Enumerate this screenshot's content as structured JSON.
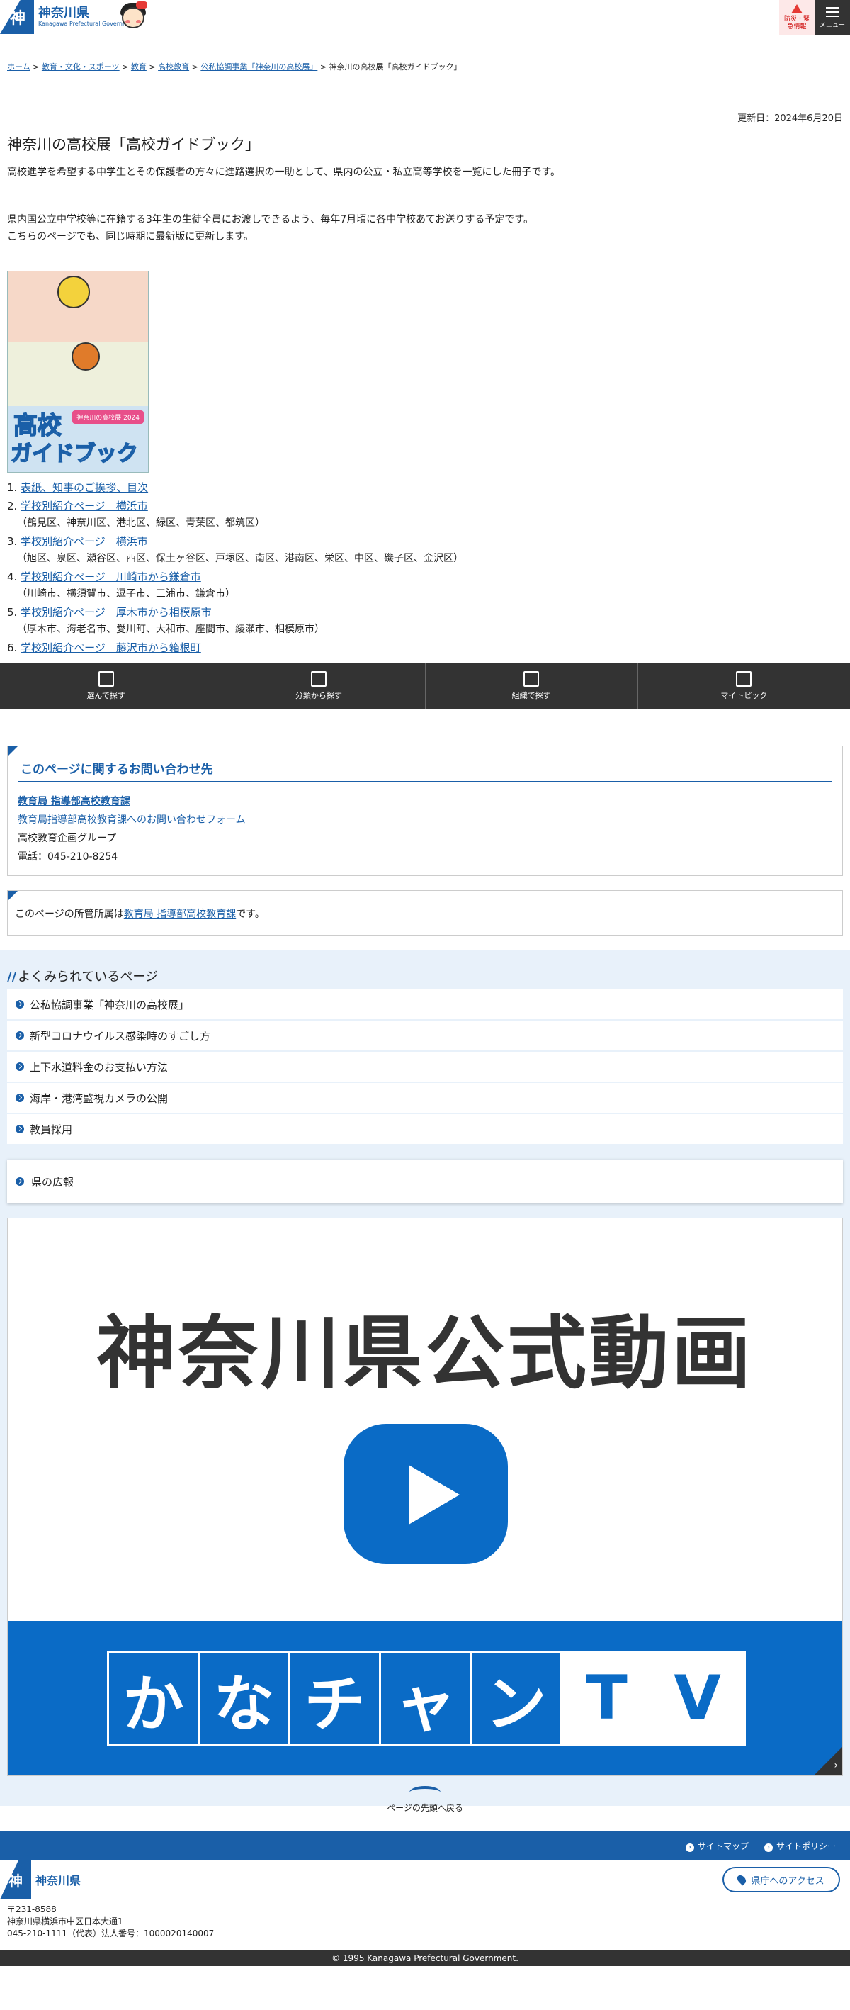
{
  "header": {
    "logo_jp": "神奈川県",
    "logo_en": "Kanagawa Prefectural Government",
    "logo_mark": "神",
    "alert_label_1": "防災・緊",
    "alert_label_2": "急情報",
    "menu_label": "メニュー"
  },
  "breadcrumb": {
    "items": [
      "ホーム",
      "教育・文化・スポーツ",
      "教育",
      "高校教育",
      "公私協調事業「神奈川の高校展」"
    ],
    "current": "神奈川の高校展「高校ガイドブック」",
    "sep": " > "
  },
  "page": {
    "updated": "更新日：2024年6月20日",
    "title": "神奈川の高校展「高校ガイドブック」",
    "intro": "高校進学を希望する中学生とその保護者の方々に進路選択の一助として、県内の公立・私立高等学校を一覧にした冊子です。",
    "para2_line1": "県内国公立中学校等に在籍する3年生の生徒全員にお渡しできるよう、毎年7月頃に各中学校あてお送りする予定です。",
    "para2_line2": "こちらのページでも、同じ時期に最新版に更新します。"
  },
  "cover": {
    "title1": "高校",
    "title2": "ガイドブック",
    "badge": "神奈川の高校展 2024"
  },
  "list": [
    {
      "num": "1.",
      "link": "表紙、知事のご挨拶、目次",
      "sub": ""
    },
    {
      "num": "2.",
      "link": "学校別紹介ページ　横浜市",
      "sub": "（鶴見区、神奈川区、港北区、緑区、青葉区、都筑区）"
    },
    {
      "num": "3.",
      "link": "学校別紹介ページ　横浜市",
      "sub": "（旭区、泉区、瀬谷区、西区、保土ヶ谷区、戸塚区、南区、港南区、栄区、中区、磯子区、金沢区）"
    },
    {
      "num": "4.",
      "link": "学校別紹介ページ　川崎市から鎌倉市",
      "sub": "（川崎市、横須賀市、逗子市、三浦市、鎌倉市）"
    },
    {
      "num": "5.",
      "link": "学校別紹介ページ　厚木市から相模原市",
      "sub": "（厚木市、海老名市、愛川町、大和市、座間市、綾瀬市、相模原市）"
    },
    {
      "num": "6.",
      "link": "学校別紹介ページ　藤沢市から箱根町",
      "sub": ""
    }
  ],
  "bottom_nav": [
    "選んで探す",
    "分類から探す",
    "組織で探す",
    "マイトピック"
  ],
  "contact": {
    "heading": "このページに関するお問い合わせ先",
    "dept": "教育局 指導部高校教育課",
    "form": "教育局指導部高校教育課へのお問い合わせフォーム",
    "group": "高校教育企画グループ",
    "tel": "電話：045-210-8254"
  },
  "owner": {
    "prefix": "このページの所管所属は",
    "link": "教育局 指導部高校教育課",
    "suffix": "です。"
  },
  "popular": {
    "heading": "よくみられているページ",
    "items": [
      "公私協調事業「神奈川の高校展」",
      "新型コロナウイルス感染時のすごし方",
      "上下水道料金のお支払い方法",
      "海岸・港湾監視カメラの公開",
      "教員採用"
    ],
    "kenno": "県の広報"
  },
  "video": {
    "title": "神奈川県公式動画",
    "tiles": [
      "か",
      "な",
      "チ",
      "ャ",
      "ン",
      "T",
      "V"
    ]
  },
  "totop": "ページの先頭へ戻る",
  "footer": {
    "links": [
      "サイトマップ",
      "サイトポリシー"
    ],
    "name": "神奈川県",
    "access": "県庁へのアクセス",
    "zip": "〒231-8588",
    "address": "神奈川県横浜市中区日本大通1",
    "tel": "045-210-1111（代表）法人番号：1000020140007",
    "copyright": "© 1995 Kanagawa Prefectural Government."
  },
  "colors": {
    "brand": "#1a5fa8",
    "dark": "#333333",
    "popular_bg": "#e8f1fa",
    "video_blue": "#0a6bc6"
  }
}
